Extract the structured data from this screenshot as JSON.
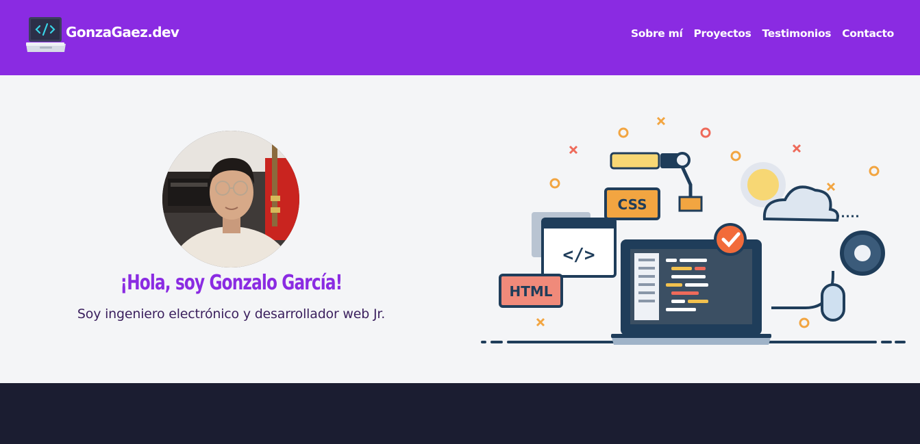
{
  "header": {
    "brand": {
      "name": "GonzaGaez.dev",
      "logo_icon": "laptop-code-icon"
    },
    "nav": [
      {
        "label": "Sobre mí"
      },
      {
        "label": "Proyectos"
      },
      {
        "label": "Testimonios"
      },
      {
        "label": "Contacto"
      }
    ]
  },
  "hero": {
    "title": "¡Hola, soy Gonzalo García!",
    "subtitle": "Soy ingeniero electrónico y desarrollador web Jr.",
    "avatar_icon": "profile-photo",
    "illustration": {
      "badge_css": "CSS",
      "badge_html": "HTML",
      "code_glyph": "</>"
    }
  },
  "colors": {
    "primary": "#8a2be2",
    "background": "#f4f5f7",
    "footer": "#1b1d31",
    "subtitle": "#3a1f5d"
  }
}
